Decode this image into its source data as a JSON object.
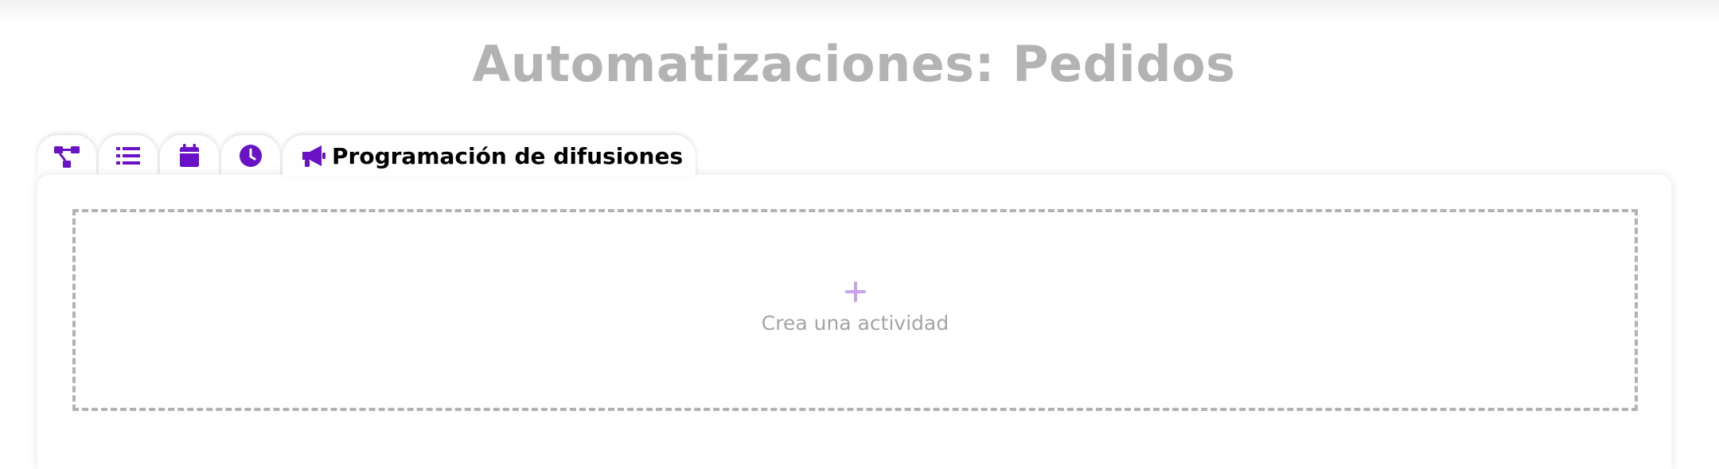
{
  "page": {
    "title": "Automatizaciones: Pedidos"
  },
  "tabs": [
    {
      "icon": "flow-diagram-icon",
      "label": ""
    },
    {
      "icon": "list-icon",
      "label": ""
    },
    {
      "icon": "calendar-icon",
      "label": ""
    },
    {
      "icon": "clock-icon",
      "label": ""
    },
    {
      "icon": "megaphone-icon",
      "label": "Programación de difusiones",
      "active": true
    }
  ],
  "dropzone": {
    "icon": "plus-icon",
    "label": "Crea una actividad"
  },
  "colors": {
    "accent": "#6a12c8",
    "title": "#b3b3b3",
    "plus": "#c9a3ee",
    "border": "#b2b2b2"
  }
}
